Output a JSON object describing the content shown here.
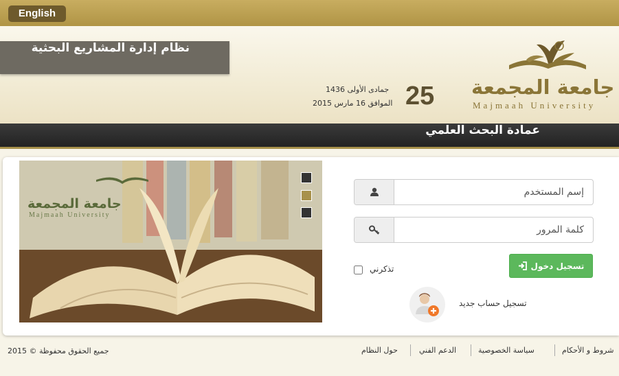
{
  "topbar": {
    "language_label": "English"
  },
  "header": {
    "system_title": "نظام إدارة المشاريع البحثية",
    "date": {
      "day": "25",
      "hijri": "جمادى الأولى 1436",
      "gregorian": "الموافق 16 مارس 2015"
    },
    "logo": {
      "arabic": "جامعة المجمعة",
      "english": "Majmaah University"
    }
  },
  "deanship": {
    "title": "عمادة البحث العلمي"
  },
  "slider": {
    "logo_arabic": "جامعة المجمعة",
    "logo_english": "Majmaah University",
    "dot_colors": [
      "#333333",
      "#a8914b",
      "#333333"
    ]
  },
  "login": {
    "username_placeholder": "إسم المستخدم",
    "password_placeholder": "كلمة المرور",
    "login_button": "تسجيل دخول",
    "remember_me": "تذكرني",
    "register": "تسجيل حساب جديد"
  },
  "footer": {
    "copyright": "جميع الحقوق محفوظة © 2015",
    "links": [
      "حول النظام",
      "الدعم الفني",
      "سياسة الخصوصية",
      "شروط و الأحكام"
    ]
  },
  "colors": {
    "gold": "#b09445",
    "dark_bar": "#2b2b2b",
    "green_button": "#5cb85c"
  }
}
